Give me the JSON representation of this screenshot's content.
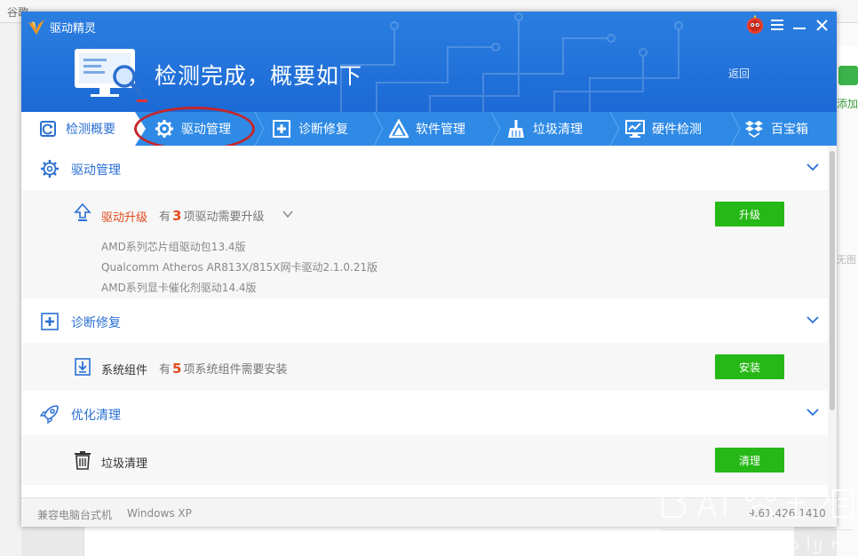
{
  "browser": {
    "bookmark_1": "谷歌",
    "sidebar_add": "添加",
    "sidebar_none": "无图"
  },
  "window": {
    "title": "驱动精灵",
    "hero_title": "检测完成，概要如下",
    "back_label": "返回"
  },
  "tabs": [
    {
      "label": "检测概要",
      "icon": "refresh-icon"
    },
    {
      "label": "驱动管理",
      "icon": "gear-icon"
    },
    {
      "label": "诊断修复",
      "icon": "medical-cross-icon"
    },
    {
      "label": "软件管理",
      "icon": "triangle-app-icon"
    },
    {
      "label": "垃圾清理",
      "icon": "broom-icon"
    },
    {
      "label": "硬件检测",
      "icon": "monitor-chart-icon"
    },
    {
      "label": "百宝箱",
      "icon": "box-icon"
    }
  ],
  "sections": {
    "driver": {
      "title": "驱动管理",
      "row_title": "驱动升级",
      "row_prefix": "有",
      "row_count": "3",
      "row_suffix": "项驱动需要升级",
      "items": [
        "AMD系列芯片组驱动包13.4版",
        "Qualcomm Atheros AR813X/815X网卡驱动2.1.0.21版",
        "AMD系列显卡催化剂驱动14.4版"
      ],
      "button": "升级"
    },
    "diagnose": {
      "title": "诊断修复",
      "row_title": "系统组件",
      "row_prefix": "有",
      "row_count": "5",
      "row_suffix": "项系统组件需要安装",
      "button": "安装"
    },
    "optimize": {
      "title": "优化清理",
      "row_title": "垃圾清理",
      "button": "清理"
    }
  },
  "footer": {
    "machine": "兼容电脑台式机",
    "os": "Windows XP",
    "version": "9.61.426.1410"
  },
  "colors": {
    "header_blue": "#1c69d5",
    "tab_blue": "#2f8ae6",
    "accent_blue": "#2a6fd4",
    "green_button": "#26b816",
    "highlight_red": "#e24a1b"
  }
}
